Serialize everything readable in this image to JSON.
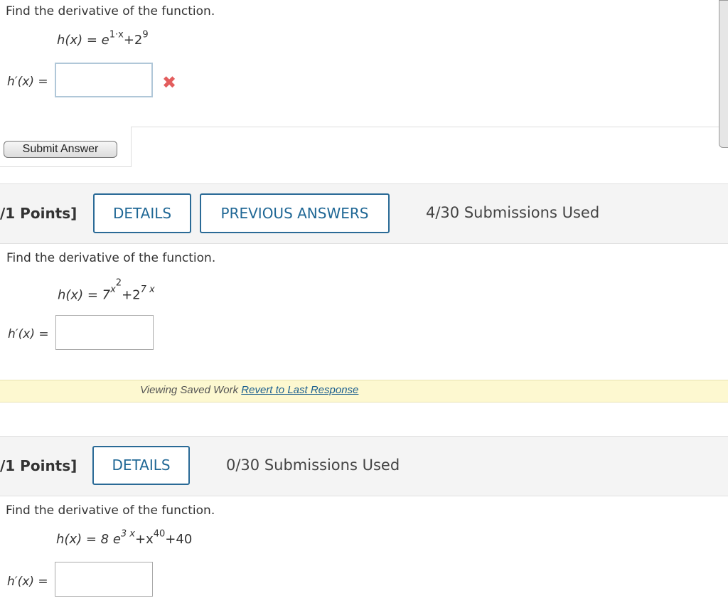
{
  "q1": {
    "prompt": "Find the derivative of the function.",
    "eq_lhs": "h(x) = ",
    "eq_base": "e",
    "eq_exp": "1·x",
    "eq_mid": "+2",
    "eq_exp2": "9",
    "answer_label_h": "h",
    "answer_label_rest": "′(x) =",
    "answer_value": "",
    "status_icon": "incorrect-x-icon",
    "submit_label": "Submit Answer"
  },
  "q2": {
    "points": "/1 Points]",
    "details_label": "DETAILS",
    "previous_label": "PREVIOUS ANSWERS",
    "submissions": "4/30 Submissions Used",
    "prompt": "Find the derivative of the function.",
    "eq_lhs": "h(x) = 7",
    "eq_exp_x": "x",
    "eq_exp_2": "2",
    "eq_mid": "+2",
    "eq_exp3": "7 x",
    "answer_label_h": "h",
    "answer_label_rest": "′(x) =",
    "answer_value": "",
    "saved_text": "Viewing Saved Work ",
    "saved_link": "Revert to Last Response"
  },
  "q3": {
    "points": "/1 Points]",
    "details_label": "DETAILS",
    "submissions": "0/30 Submissions Used",
    "prompt": "Find the derivative of the function.",
    "eq_lhs": "h(x) = 8 ",
    "eq_base": "e",
    "eq_exp": "3 x",
    "eq_mid": "+x",
    "eq_exp2": "40",
    "eq_tail": "+40",
    "answer_label_h": "h",
    "answer_label_rest": "′(x) =",
    "answer_value": ""
  },
  "colors": {
    "accent": "#1f6795",
    "error": "#e35d5d",
    "band": "#f4f4f4",
    "saved_bg": "#fdf8d0"
  }
}
